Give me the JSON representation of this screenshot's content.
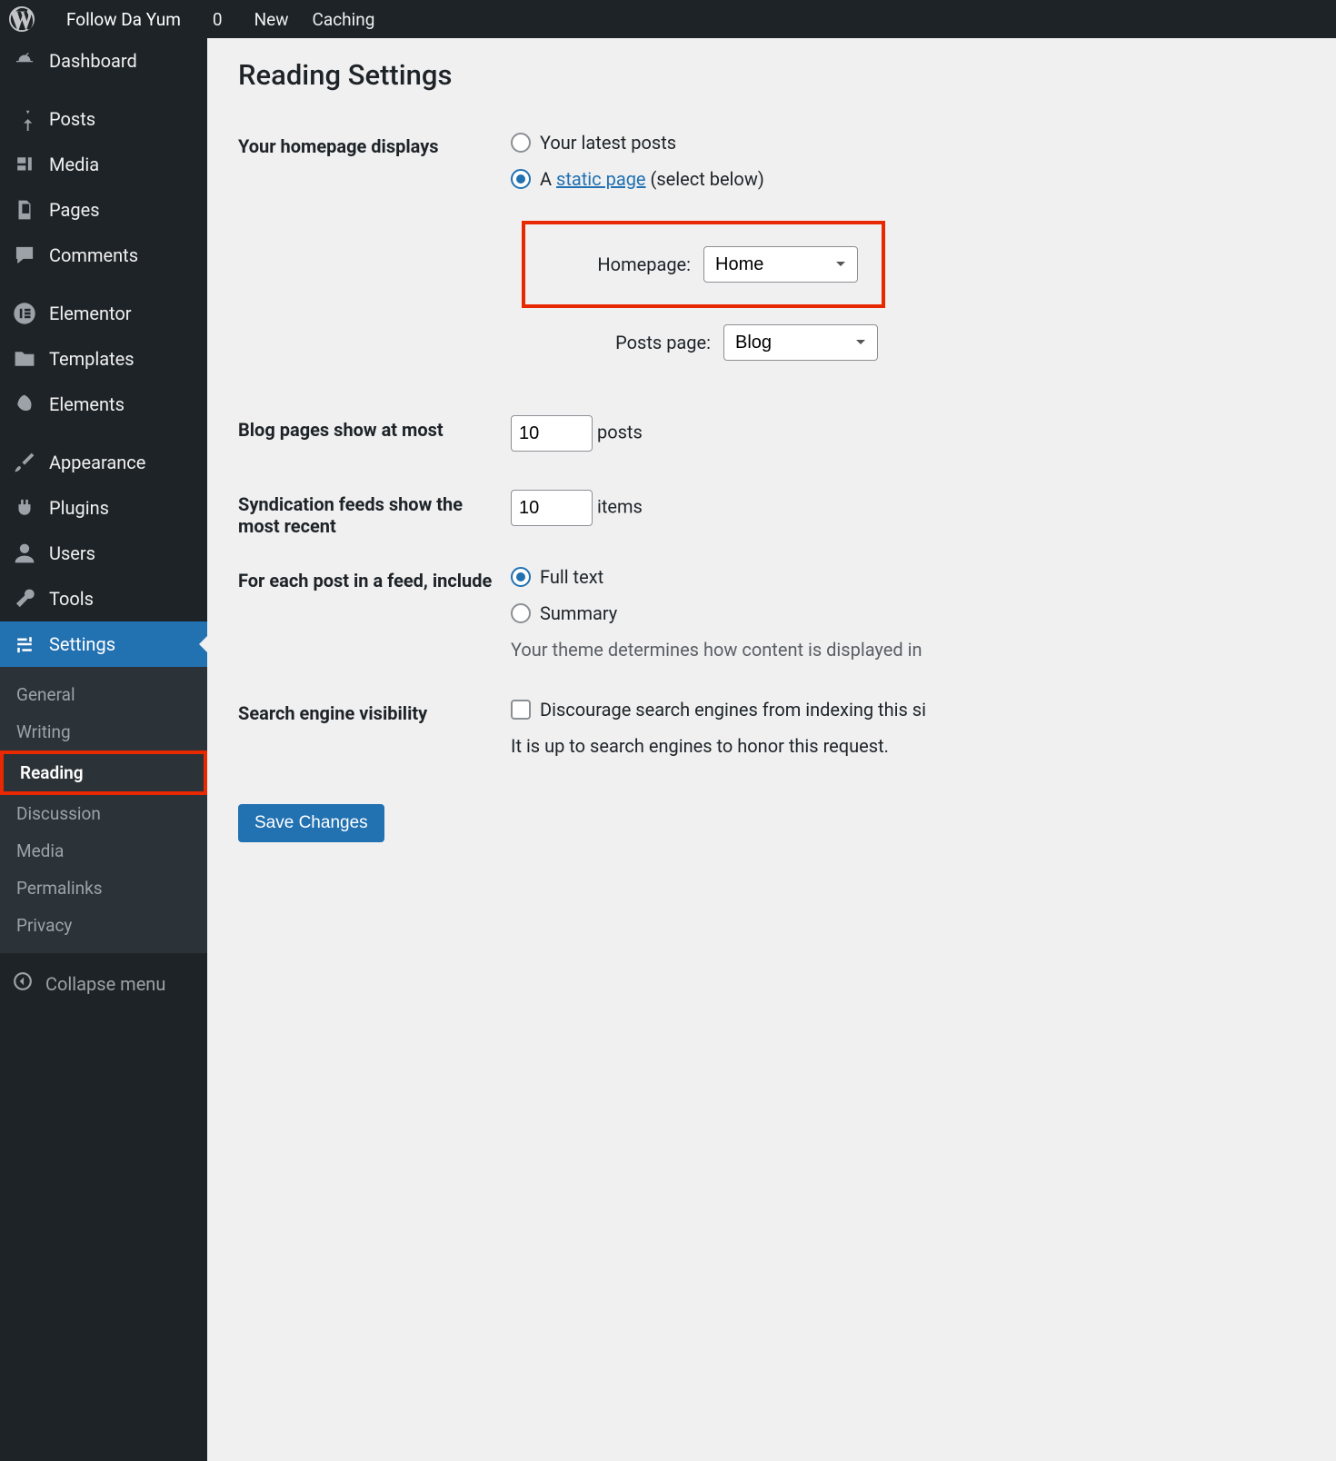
{
  "topbar": {
    "site_name": "Follow Da Yum",
    "comments_count": "0",
    "new_label": "New",
    "caching_label": "Caching"
  },
  "sidebar": {
    "items": [
      {
        "label": "Dashboard",
        "icon": "dashboard-icon"
      },
      {
        "label": "Posts",
        "icon": "pin-icon"
      },
      {
        "label": "Media",
        "icon": "media-icon"
      },
      {
        "label": "Pages",
        "icon": "pages-icon"
      },
      {
        "label": "Comments",
        "icon": "comments-icon"
      },
      {
        "label": "Elementor",
        "icon": "elementor-icon"
      },
      {
        "label": "Templates",
        "icon": "folder-icon"
      },
      {
        "label": "Elements",
        "icon": "leaf-icon"
      },
      {
        "label": "Appearance",
        "icon": "brush-icon"
      },
      {
        "label": "Plugins",
        "icon": "plugin-icon"
      },
      {
        "label": "Users",
        "icon": "user-icon"
      },
      {
        "label": "Tools",
        "icon": "wrench-icon"
      },
      {
        "label": "Settings",
        "icon": "settings-icon"
      }
    ],
    "submenu": {
      "items": [
        {
          "label": "General"
        },
        {
          "label": "Writing"
        },
        {
          "label": "Reading",
          "current": true
        },
        {
          "label": "Discussion"
        },
        {
          "label": "Media"
        },
        {
          "label": "Permalinks"
        },
        {
          "label": "Privacy"
        }
      ]
    },
    "collapse_label": "Collapse menu"
  },
  "page": {
    "title": "Reading Settings",
    "homepage_section": {
      "label": "Your homepage displays",
      "opt_latest": "Your latest posts",
      "opt_static_prefix": "A ",
      "opt_static_link": "static page",
      "opt_static_suffix": " (select below)",
      "homepage_label": "Homepage:",
      "homepage_value": "Home",
      "posts_page_label": "Posts page:",
      "posts_page_value": "Blog"
    },
    "blog_pages": {
      "label": "Blog pages show at most",
      "value": "10",
      "suffix": "posts"
    },
    "syndication": {
      "label": "Syndication feeds show the most recent",
      "value": "10",
      "suffix": "items"
    },
    "feed_content": {
      "label": "For each post in a feed, include",
      "opt_full": "Full text",
      "opt_summary": "Summary",
      "desc": "Your theme determines how content is displayed in"
    },
    "search_visibility": {
      "label": "Search engine visibility",
      "checkbox_label": "Discourage search engines from indexing this si",
      "desc": "It is up to search engines to honor this request."
    },
    "save_label": "Save Changes"
  }
}
